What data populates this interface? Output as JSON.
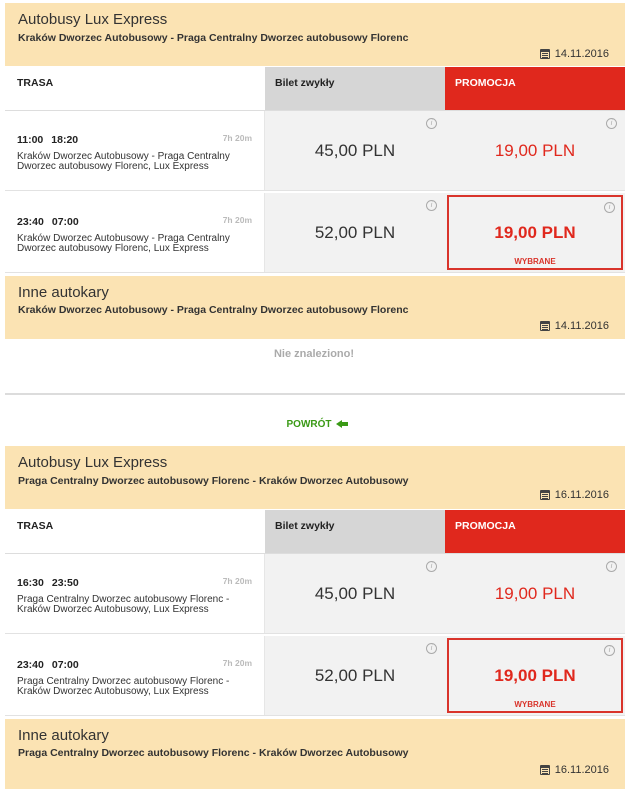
{
  "outbound": {
    "header": {
      "title": "Autobusy Lux Express",
      "route": "Kraków Dworzec Autobusowy - Praga Centralny Dworzec autobusowy Florenc",
      "date": "14.11.2016"
    },
    "columns": {
      "route": "TRASA",
      "regular": "Bilet zwykły",
      "promo": "PROMOCJA"
    },
    "rows": [
      {
        "depart": "11:00",
        "arrive": "18:20",
        "duration": "7h 20m",
        "connection": "Kraków Dworzec Autobusowy - Praga Centralny Dworzec autobusowy Florenc, Lux Express",
        "regular_price": "45,00 PLN",
        "promo_price": "19,00 PLN"
      },
      {
        "depart": "23:40",
        "arrive": "07:00",
        "duration": "7h 20m",
        "connection": "Kraków Dworzec Autobusowy - Praga Centralny Dworzec autobusowy Florenc, Lux Express",
        "regular_price": "52,00 PLN",
        "promo_price": "19,00 PLN",
        "selected_label": "WYBRANE"
      }
    ],
    "other": {
      "title": "Inne autokary",
      "route": "Kraków Dworzec Autobusowy - Praga Centralny Dworzec autobusowy Florenc",
      "date": "14.11.2016",
      "empty": "Nie znaleziono!"
    }
  },
  "back_link": "POWRÓT",
  "return": {
    "header": {
      "title": "Autobusy Lux Express",
      "route": "Praga Centralny Dworzec autobusowy Florenc - Kraków Dworzec Autobusowy",
      "date": "16.11.2016"
    },
    "columns": {
      "route": "TRASA",
      "regular": "Bilet zwykły",
      "promo": "PROMOCJA"
    },
    "rows": [
      {
        "depart": "16:30",
        "arrive": "23:50",
        "duration": "7h 20m",
        "connection": "Praga Centralny Dworzec autobusowy Florenc - Kraków Dworzec Autobusowy, Lux Express",
        "regular_price": "45,00 PLN",
        "promo_price": "19,00 PLN"
      },
      {
        "depart": "23:40",
        "arrive": "07:00",
        "duration": "7h 20m",
        "connection": "Praga Centralny Dworzec autobusowy Florenc - Kraków Dworzec Autobusowy, Lux Express",
        "regular_price": "52,00 PLN",
        "promo_price": "19,00 PLN",
        "selected_label": "WYBRANE"
      }
    ],
    "other": {
      "title": "Inne autokary",
      "route": "Praga Centralny Dworzec autobusowy Florenc - Kraków Dworzec Autobusowy",
      "date": "16.11.2016"
    }
  },
  "colors": {
    "panel": "#fbe3b3",
    "promo": "#e0281d",
    "back": "#3a9a16"
  }
}
